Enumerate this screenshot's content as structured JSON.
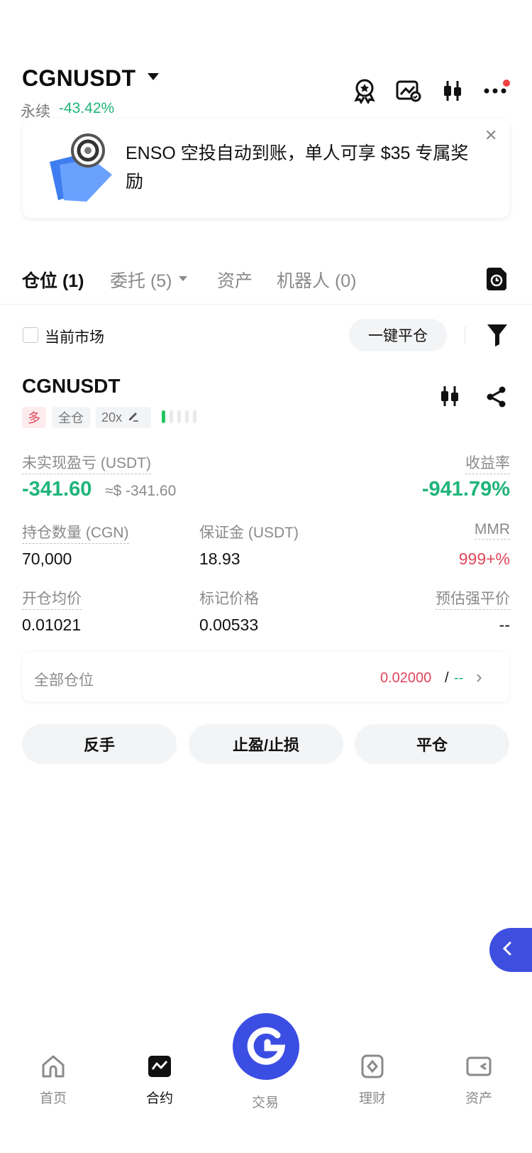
{
  "header": {
    "pair": "CGNUSDT",
    "contract_type": "永续",
    "change": "-43.42%"
  },
  "banner": {
    "text": "ENSO 空投自动到账，单人可享 $35 专属奖励",
    "close": "✕"
  },
  "tabs": [
    {
      "label": "仓位 (1)",
      "active": true
    },
    {
      "label": "委托 (5)",
      "active": false
    },
    {
      "label": "资产",
      "active": false
    },
    {
      "label": "机器人 (0)",
      "active": false
    }
  ],
  "filter": {
    "current_market_label": "当前市场",
    "close_all_label": "一键平仓"
  },
  "position": {
    "symbol": "CGNUSDT",
    "side": "多",
    "margin_mode": "全仓",
    "leverage": "20x",
    "unrealized_pnl_label": "未实现盈亏 (USDT)",
    "unrealized_pnl": "-341.60",
    "unrealized_pnl_usd": "≈$ -341.60",
    "roe_label": "收益率",
    "roe": "-941.79%",
    "size_label": "持仓数量 (CGN)",
    "size": "70,000",
    "margin_label": "保证金 (USDT)",
    "margin": "18.93",
    "mmr_label": "MMR",
    "mmr": "999+%",
    "entry_price_label": "开仓均价",
    "entry_price": "0.01021",
    "mark_price_label": "标记价格",
    "mark_price": "0.00533",
    "liq_price_label": "预估强平价",
    "liq_price": "--",
    "all_positions_label": "全部仓位",
    "all_positions_value": "0.02000",
    "all_positions_sep": "/",
    "all_positions_dash": "--",
    "chevron": "›"
  },
  "actions": {
    "reverse": "反手",
    "tp_sl": "止盈/止损",
    "close": "平仓"
  },
  "nav": {
    "home": "首页",
    "futures": "合约",
    "trade": "交易",
    "earn": "理财",
    "assets": "资产"
  },
  "colors": {
    "green": "#1fb47a",
    "red": "#e0465a",
    "accent": "#3b4ee3"
  }
}
